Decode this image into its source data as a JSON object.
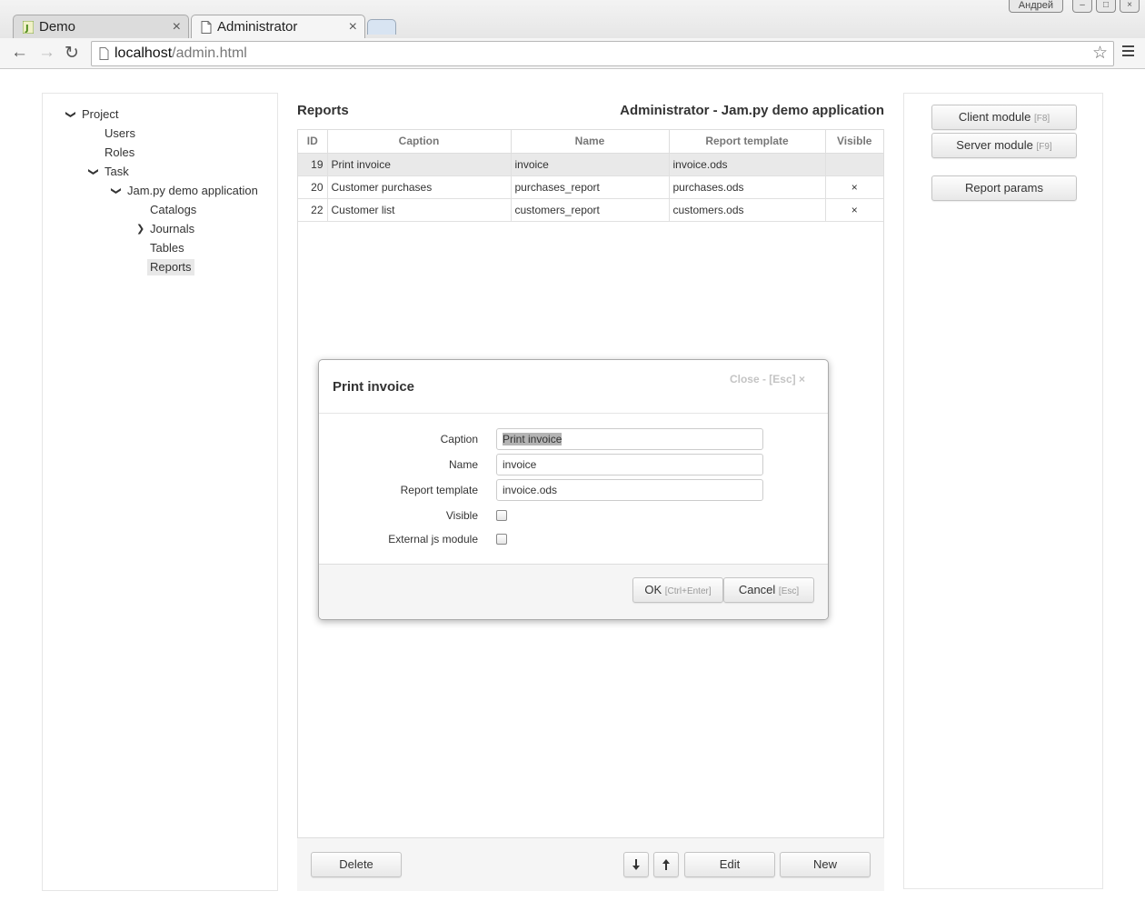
{
  "browser": {
    "tabs": [
      {
        "label": "Demo",
        "active": false
      },
      {
        "label": "Administrator",
        "active": true
      }
    ],
    "tab_close": "×",
    "user_chip": "Андрей",
    "url_host": "localhost",
    "url_path": "/admin.html"
  },
  "sidebar": {
    "items": [
      {
        "label": "Project"
      },
      {
        "label": "Users"
      },
      {
        "label": "Roles"
      },
      {
        "label": "Task"
      },
      {
        "label": "Jam.py demo application"
      },
      {
        "label": "Catalogs"
      },
      {
        "label": "Journals"
      },
      {
        "label": "Tables"
      },
      {
        "label": "Reports",
        "selected": true
      }
    ]
  },
  "main": {
    "title": "Reports",
    "app_title": "Administrator - Jam.py demo application",
    "columns": [
      "ID",
      "Caption",
      "Name",
      "Report template",
      "Visible"
    ],
    "rows": [
      {
        "id": "19",
        "caption": "Print invoice",
        "name": "invoice",
        "template": "invoice.ods",
        "visible": ""
      },
      {
        "id": "20",
        "caption": "Customer purchases",
        "name": "purchases_report",
        "template": "purchases.ods",
        "visible": "×"
      },
      {
        "id": "22",
        "caption": "Customer list",
        "name": "customers_report",
        "template": "customers.ods",
        "visible": "×"
      }
    ],
    "buttons": {
      "delete": "Delete",
      "edit": "Edit",
      "new": "New"
    }
  },
  "right_panel": {
    "client_module": "Client module",
    "client_module_hint": "[F8]",
    "server_module": "Server module",
    "server_module_hint": "[F9]",
    "report_params": "Report params"
  },
  "modal": {
    "title": "Print invoice",
    "close_label": "Close - [Esc] ×",
    "fields": {
      "caption_label": "Caption",
      "caption_value": "Print invoice",
      "name_label": "Name",
      "name_value": "invoice",
      "template_label": "Report template",
      "template_value": "invoice.ods",
      "visible_label": "Visible",
      "external_label": "External js module"
    },
    "ok": "OK",
    "ok_hint": "[Ctrl+Enter]",
    "cancel": "Cancel",
    "cancel_hint": "[Esc]"
  }
}
